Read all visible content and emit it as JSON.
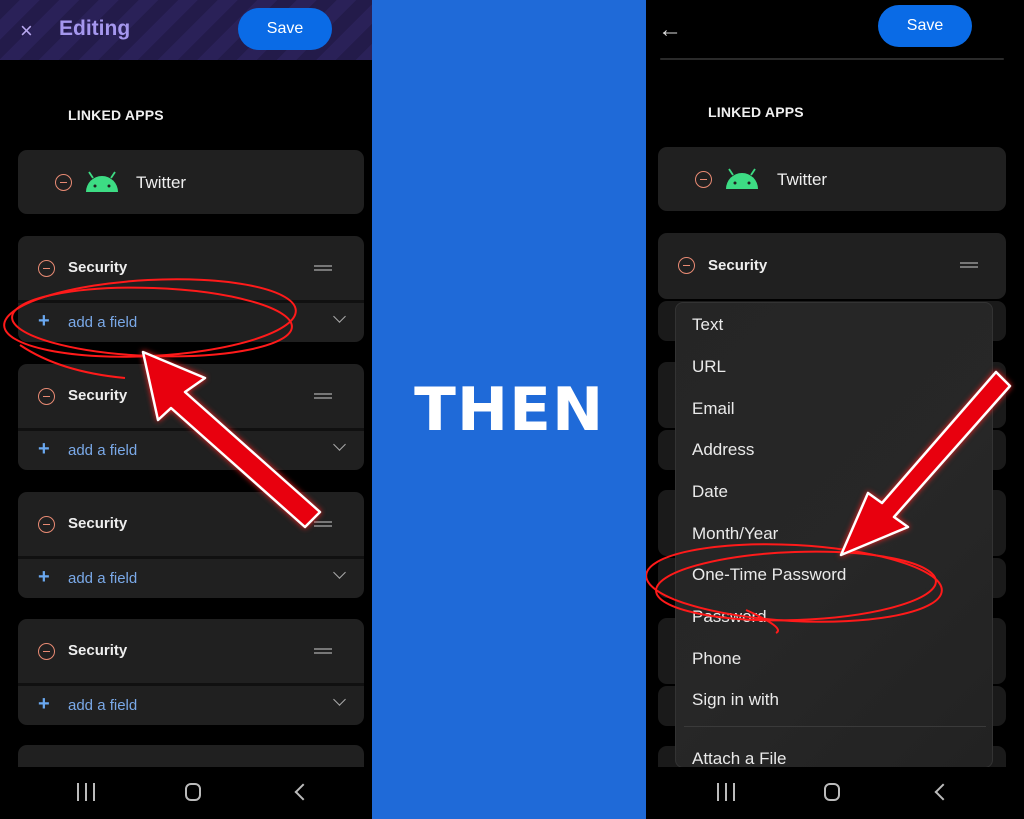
{
  "left": {
    "topbar": {
      "close_icon": "×",
      "title": "Editing",
      "save_label": "Save"
    },
    "section_label": "LINKED APPS",
    "linked_app": {
      "name": "Twitter",
      "icon": "android-icon"
    },
    "security_cards": [
      {
        "title": "Security",
        "add_label": "add a field"
      },
      {
        "title": "Security",
        "add_label": "add a field"
      },
      {
        "title": "Security",
        "add_label": "add a field"
      },
      {
        "title": "Security",
        "add_label": "add a field"
      }
    ],
    "navbar": [
      "recent-apps",
      "home",
      "back"
    ]
  },
  "middle": {
    "label": "THEN",
    "background": "#1f6ad8"
  },
  "right": {
    "topbar": {
      "back_icon": "←",
      "save_label": "Save"
    },
    "section_label": "LINKED APPS",
    "linked_app": {
      "name": "Twitter",
      "icon": "android-icon"
    },
    "security_card": {
      "title": "Security"
    },
    "field_type_menu": {
      "items": [
        "Text",
        "URL",
        "Email",
        "Address",
        "Date",
        "Month/Year",
        "One-Time Password",
        "Password",
        "Phone",
        "Sign in with"
      ],
      "footer_item": "Attach a File",
      "highlighted": "One-Time Password"
    },
    "navbar": [
      "recent-apps",
      "home",
      "back"
    ]
  },
  "colors": {
    "accent": "#0a6be6",
    "remove": "#e88a73",
    "link": "#7aa9e8",
    "android": "#3ddc84",
    "annotation": "#ff1a1a"
  }
}
